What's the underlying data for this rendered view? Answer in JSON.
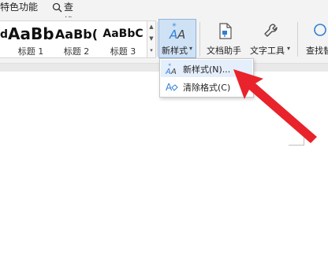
{
  "menubar": {
    "features_label": "特色功能",
    "search_label": "查找"
  },
  "styles_gallery": {
    "items": [
      {
        "preview": "d",
        "label": ""
      },
      {
        "preview": "AaBb",
        "label": "标题 1"
      },
      {
        "preview": "AaBb(",
        "label": "标题 2"
      },
      {
        "preview": "AaBbC",
        "label": "标题 3"
      }
    ]
  },
  "ribbon": {
    "new_style_label": "新样式",
    "doc_assistant_label": "文档助手",
    "text_tools_label": "文字工具",
    "find_replace_label": "查找替"
  },
  "dropdown": {
    "items": [
      {
        "label": "新样式(N)..."
      },
      {
        "label": "清除格式(C)"
      }
    ]
  },
  "colors": {
    "accent": "#2f7fd6",
    "highlight": "#cfe1f5",
    "arrow": "#e8232b"
  }
}
